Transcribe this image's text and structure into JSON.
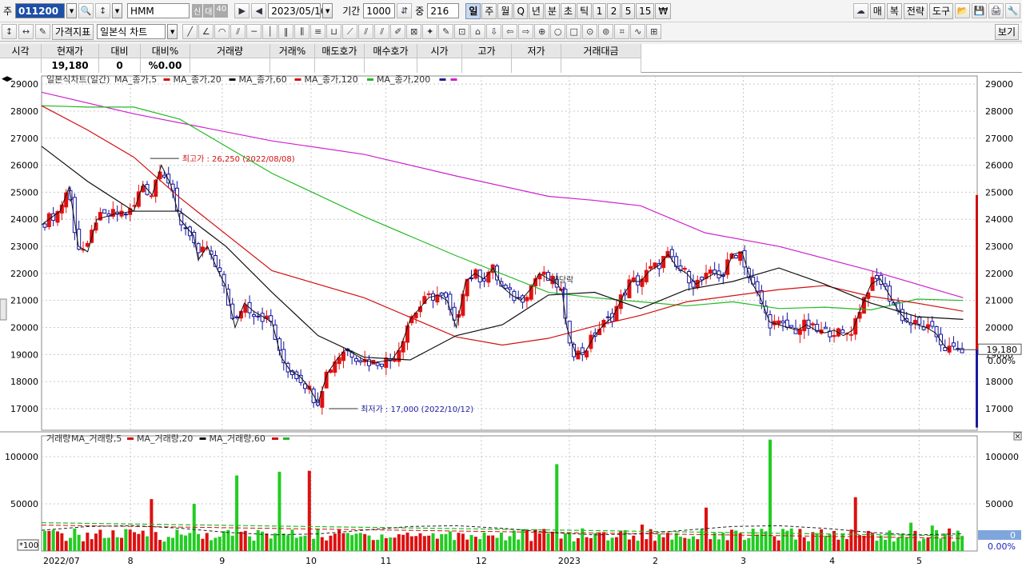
{
  "toolbar1": {
    "market_label": "주",
    "code": "011200",
    "stock_name": "HMM",
    "badges": [
      "신",
      "대",
      "40"
    ],
    "date": "2023/05/16",
    "period_label": "기간",
    "period_value": "1000",
    "middle_label": "중",
    "middle_value": "216",
    "intervals": [
      "일",
      "주",
      "월",
      "Q",
      "년",
      "분",
      "초",
      "틱",
      "1",
      "2",
      "5",
      "15",
      "₩"
    ],
    "selected_interval": "일",
    "right_buttons": [
      "매",
      "복",
      "전략",
      "도구"
    ]
  },
  "toolbar2": {
    "price_indicator": "가격지표",
    "chart_type": "일본식 차트",
    "settings_label": "보기"
  },
  "quote": {
    "headers": [
      "시각",
      "현재가",
      "대비",
      "대비%",
      "거래량",
      "거래%",
      "매도호가",
      "매수호가",
      "시가",
      "고가",
      "저가",
      "거래대금"
    ],
    "values": [
      "",
      "19,180",
      "0",
      "%0.00",
      "",
      "",
      "",
      "",
      "",
      "",
      "",
      ""
    ]
  },
  "price_panel": {
    "legend_title": "일본식차트(일간)",
    "legend": [
      {
        "name": "MA_종가,5",
        "color": "#d01010"
      },
      {
        "name": "MA_종가,20",
        "color": "#101010"
      },
      {
        "name": "MA_종가,60",
        "color": "#d01010"
      },
      {
        "name": "MA_종가,120",
        "color": "#22bb22"
      },
      {
        "name": "MA_종가,200",
        "color": "#202090"
      },
      {
        "name": "",
        "color": "#cc22cc"
      }
    ],
    "high_label": "최고가 : 26,250 (2022/08/08)",
    "low_label": "최저가 : 17,000 (2022/10/12)",
    "event_label": "배당락",
    "current_price": "19,180",
    "current_pct": "0.00%"
  },
  "volume_panel": {
    "legend_title": "거래량",
    "legend": [
      {
        "name": "MA_거래량,5",
        "color": "#d01010"
      },
      {
        "name": "MA_거래량,20",
        "color": "#101010"
      },
      {
        "name": "MA_거래량,60",
        "color": "#d01010"
      },
      {
        "name": "",
        "color": "#22bb22"
      }
    ],
    "scale_label": "*100",
    "current_volume": "0",
    "current_pct": "0.00%"
  },
  "x_axis": {
    "labels": [
      "2022/07",
      "8",
      "9",
      "10",
      "11",
      "12",
      "2023",
      "2",
      "3",
      "4",
      "5"
    ]
  },
  "chart_data": {
    "type": "candlestick",
    "price_y_ticks": [
      17000,
      18000,
      19000,
      20000,
      21000,
      22000,
      23000,
      24000,
      25000,
      26000,
      27000,
      28000,
      29000
    ],
    "volume_y_ticks": [
      50000,
      100000
    ],
    "price_ylim": [
      16200,
      29300
    ],
    "volume_ylim": [
      0,
      122000
    ],
    "series": [
      {
        "name": "MA_종가,200",
        "points": [
          [
            0,
            28700
          ],
          [
            0.1,
            27900
          ],
          [
            0.25,
            26900
          ],
          [
            0.35,
            26400
          ],
          [
            0.45,
            25600
          ],
          [
            0.55,
            24850
          ],
          [
            0.6,
            24700
          ],
          [
            0.65,
            24500
          ],
          [
            0.72,
            23500
          ],
          [
            0.8,
            23000
          ],
          [
            0.9,
            22100
          ],
          [
            1.0,
            21100
          ]
        ]
      },
      {
        "name": "MA_종가,120",
        "points": [
          [
            0,
            28200
          ],
          [
            0.05,
            28150
          ],
          [
            0.1,
            28150
          ],
          [
            0.15,
            27700
          ],
          [
            0.25,
            25700
          ],
          [
            0.35,
            24100
          ],
          [
            0.45,
            22650
          ],
          [
            0.55,
            21300
          ],
          [
            0.6,
            21100
          ],
          [
            0.65,
            20950
          ],
          [
            0.7,
            20800
          ],
          [
            0.75,
            20950
          ],
          [
            0.8,
            20700
          ],
          [
            0.85,
            20750
          ],
          [
            0.9,
            20650
          ],
          [
            0.95,
            21050
          ],
          [
            1.0,
            21000
          ]
        ]
      },
      {
        "name": "MA_종가,60",
        "points": [
          [
            0,
            28200
          ],
          [
            0.05,
            27300
          ],
          [
            0.1,
            26300
          ],
          [
            0.15,
            24800
          ],
          [
            0.25,
            22100
          ],
          [
            0.35,
            21100
          ],
          [
            0.45,
            19650
          ],
          [
            0.5,
            19350
          ],
          [
            0.55,
            19600
          ],
          [
            0.6,
            20050
          ],
          [
            0.65,
            20450
          ],
          [
            0.7,
            20950
          ],
          [
            0.8,
            21400
          ],
          [
            0.85,
            21550
          ],
          [
            0.9,
            21150
          ],
          [
            0.95,
            20900
          ],
          [
            1.0,
            20600
          ]
        ]
      },
      {
        "name": "MA_종가,20",
        "points": [
          [
            0,
            26700
          ],
          [
            0.05,
            25400
          ],
          [
            0.1,
            24300
          ],
          [
            0.15,
            24300
          ],
          [
            0.2,
            23000
          ],
          [
            0.25,
            21300
          ],
          [
            0.3,
            19700
          ],
          [
            0.35,
            18900
          ],
          [
            0.4,
            18800
          ],
          [
            0.45,
            19700
          ],
          [
            0.5,
            20100
          ],
          [
            0.55,
            21200
          ],
          [
            0.6,
            21300
          ],
          [
            0.65,
            20700
          ],
          [
            0.7,
            21400
          ],
          [
            0.75,
            21700
          ],
          [
            0.8,
            22200
          ],
          [
            0.85,
            21600
          ],
          [
            0.9,
            20900
          ],
          [
            0.95,
            20400
          ],
          [
            1.0,
            20300
          ]
        ]
      }
    ],
    "high": {
      "value": 26250,
      "date": "2022/08/08"
    },
    "low": {
      "value": 17000,
      "date": "2022/10/12"
    },
    "last_close": 19180
  }
}
